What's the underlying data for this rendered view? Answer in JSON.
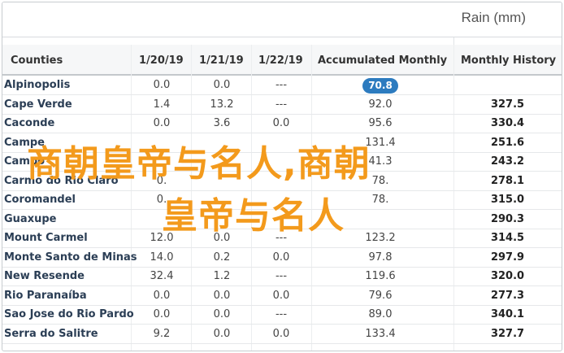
{
  "title": "Rain (mm)",
  "columns": [
    "Counties",
    "1/20/19",
    "1/21/19",
    "1/22/19",
    "Accumulated Monthly",
    "Monthly History"
  ],
  "rows": [
    {
      "county": "Alpinopolis",
      "d1": "0.0",
      "d2": "0.0",
      "d3": "---",
      "acc": "70.8",
      "hist": "",
      "highlight": true
    },
    {
      "county": "Cape Verde",
      "d1": "1.4",
      "d2": "13.2",
      "d3": "---",
      "acc": "92.0",
      "hist": "327.5"
    },
    {
      "county": "Caconde",
      "d1": "0.0",
      "d2": "3.6",
      "d3": "0.0",
      "acc": "95.6",
      "hist": "330.4"
    },
    {
      "county": "Campe",
      "d1": "",
      "d2": "",
      "d3": "",
      "acc": "131.4",
      "hist": "251.6"
    },
    {
      "county": "Campo",
      "d1": "",
      "d2": "",
      "d3": "",
      "acc": "41.3",
      "hist": "243.2"
    },
    {
      "county": "Carmo do Rio Claro",
      "d1": "0.",
      "d2": "",
      "d3": "",
      "acc": "78.",
      "hist": "278.1"
    },
    {
      "county": "Coromandel",
      "d1": "0.",
      "d2": "",
      "d3": "",
      "acc": "78.",
      "hist": "315.0"
    },
    {
      "county": "Guaxupe",
      "d1": "",
      "d2": "",
      "d3": "",
      "acc": "",
      "hist": "290.3"
    },
    {
      "county": "Mount Carmel",
      "d1": "12.0",
      "d2": "0.0",
      "d3": "---",
      "acc": "123.2",
      "hist": "314.5"
    },
    {
      "county": "Monte Santo de Minas",
      "d1": "14.0",
      "d2": "0.2",
      "d3": "0.0",
      "acc": "97.8",
      "hist": "297.9"
    },
    {
      "county": "New Resende",
      "d1": "32.4",
      "d2": "1.2",
      "d3": "---",
      "acc": "119.6",
      "hist": "320.0"
    },
    {
      "county": "Rio Paranaíba",
      "d1": "0.0",
      "d2": "0.0",
      "d3": "0.0",
      "acc": "79.6",
      "hist": "277.3"
    },
    {
      "county": "Sao Jose do Rio Pardo",
      "d1": "0.0",
      "d2": "0.0",
      "d3": "---",
      "acc": "89.0",
      "hist": "340.1"
    },
    {
      "county": "Serra do Salitre",
      "d1": "9.2",
      "d2": "0.0",
      "d3": "0.0",
      "acc": "133.4",
      "hist": "327.7"
    }
  ],
  "watermark": {
    "line1": "商朝皇帝与名人,商朝",
    "line2": "皇帝与名人",
    "color": "#f39a1c"
  },
  "colors": {
    "badge": "#2c7bbf",
    "county_text": "#2b3e55"
  }
}
